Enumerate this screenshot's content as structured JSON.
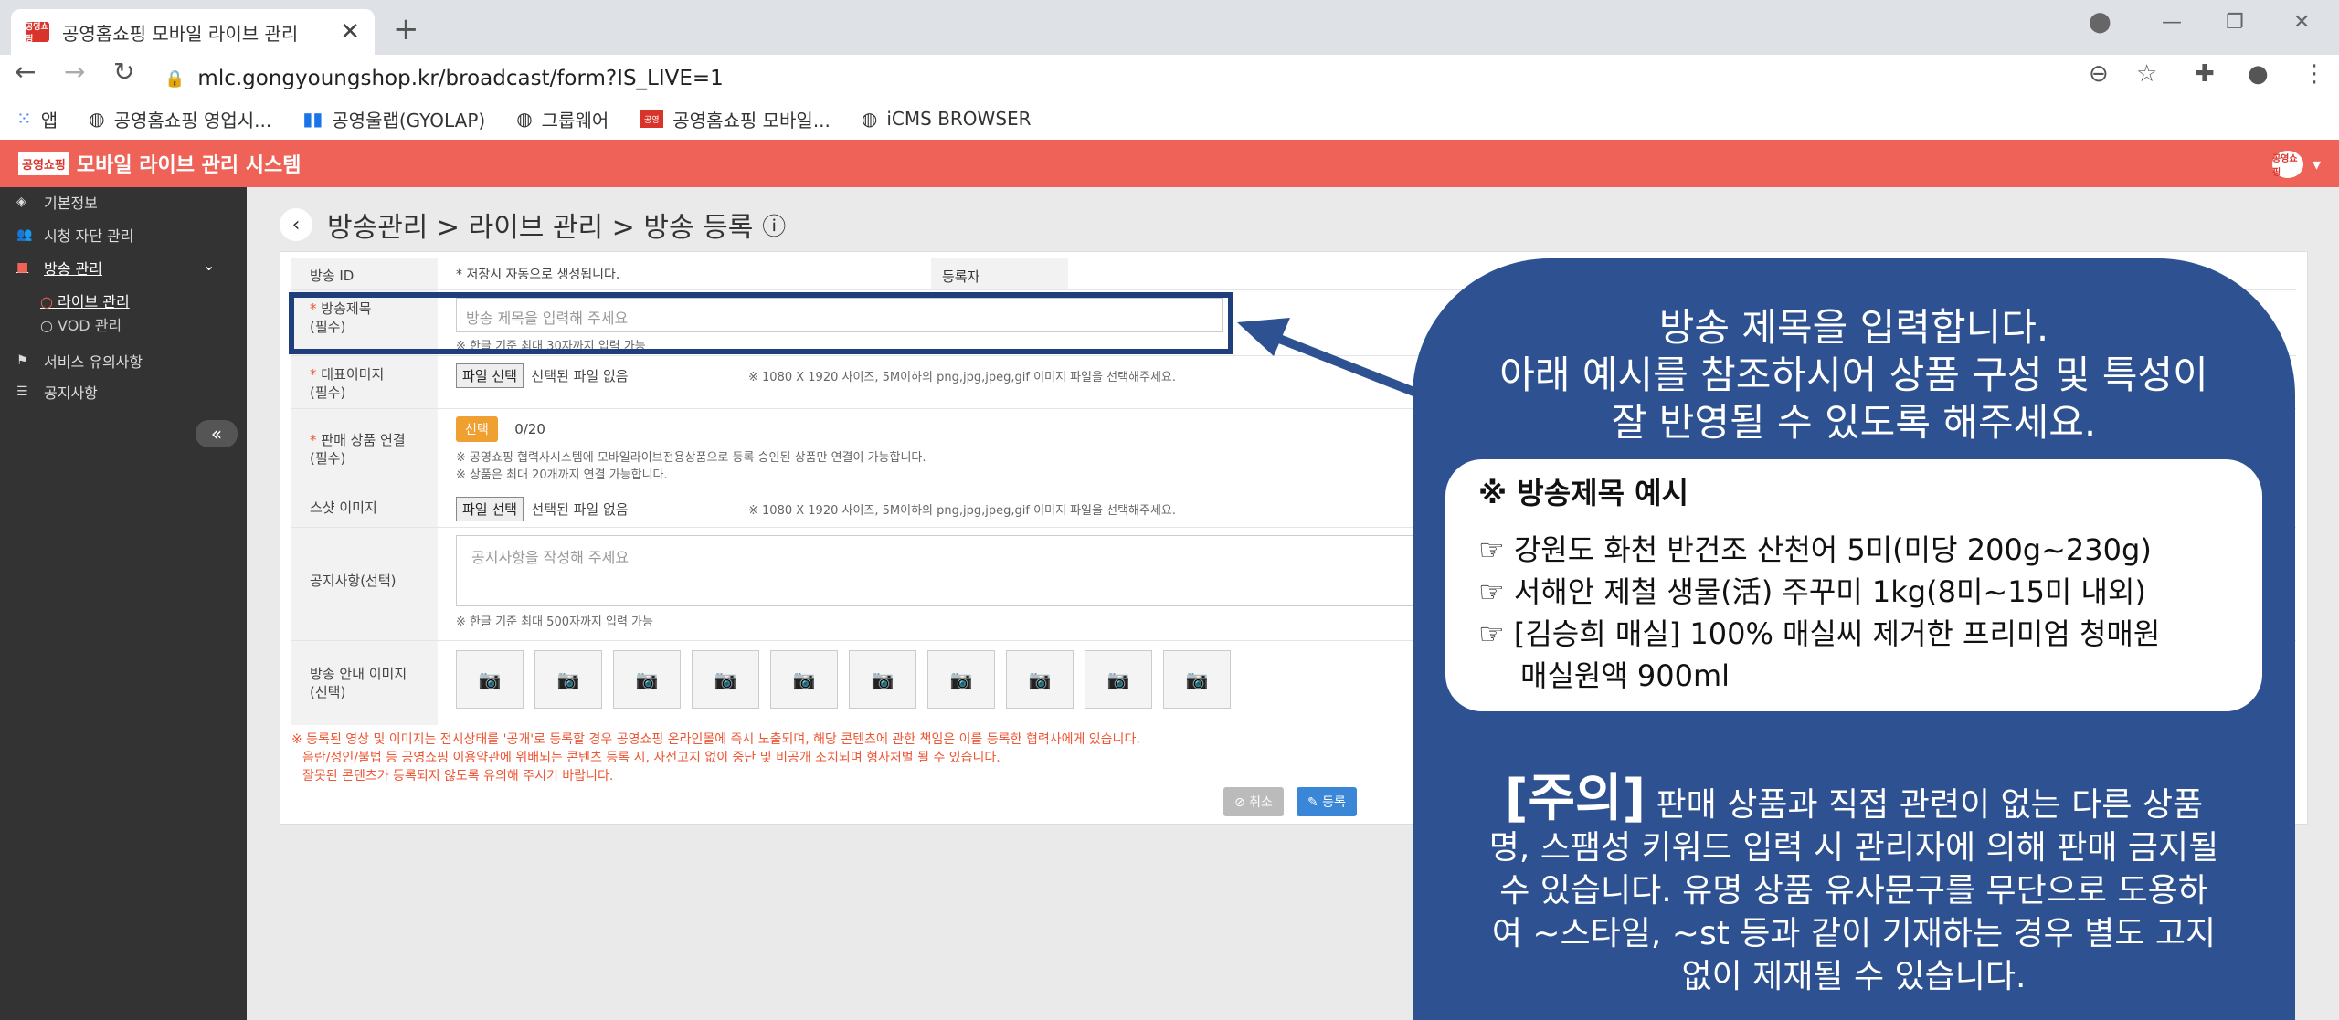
{
  "browser": {
    "tab_title": "공영홈쇼핑 모바일 라이브 관리",
    "favicon_text": "공영쇼핑",
    "new_tab": "+",
    "url_host": "mlc.gongyoungshop.kr",
    "url_path": "/broadcast/form?IS_LIVE=1",
    "bookmarks": [
      {
        "icon": "apps-icon",
        "label": "앱"
      },
      {
        "icon": "globe-icon",
        "label": "공영홈쇼핑 영업시..."
      },
      {
        "icon": "chart-icon",
        "label": "공영울랩(GYOLAP)"
      },
      {
        "icon": "globe-icon",
        "label": "그룹웨어"
      },
      {
        "icon": "brand-icon",
        "label": "공영홈쇼핑 모바일..."
      },
      {
        "icon": "globe-icon",
        "label": "iCMS BROWSER"
      }
    ]
  },
  "app": {
    "logo_text": "공영쇼핑",
    "title": "모바일 라이브 관리 시스템",
    "user_icon_text": "공영쇼핑"
  },
  "sidebar": {
    "items": [
      {
        "label": "기본정보",
        "icon": "tag-icon"
      },
      {
        "label": "시청 자단 관리",
        "icon": "users-icon"
      },
      {
        "label": "방송 관리",
        "icon": "video-icon"
      },
      {
        "label": "서비스 유의사항",
        "icon": "flag-icon"
      },
      {
        "label": "공지사항",
        "icon": "list-icon"
      }
    ],
    "sub_items": [
      {
        "label": "라이브 관리"
      },
      {
        "label": "VOD 관리"
      }
    ],
    "collapse": "«"
  },
  "breadcrumb": {
    "text": "방송관리 > 라이브 관리 > 방송 등록"
  },
  "form": {
    "broadcast_id_label": "방송 ID",
    "broadcast_id_value": "* 저장시 자동으로 생성됩니다.",
    "registrant_label": "등록자",
    "title_label": "방송제목",
    "title_req": "(필수)",
    "title_placeholder": "방송 제목을 입력해 주세요",
    "title_hint": "※ 한글 기준 최대 30자까지 입력 가능",
    "rep_image_label": "대표이미지",
    "rep_image_req": "(필수)",
    "file_button": "파일 선택",
    "file_none": "선택된 파일 없음",
    "file_hint": "※ 1080 X 1920 사이즈, 5M이하의 png,jpg,jpeg,gif 이미지 파일을 선택해주세요.",
    "product_label": "판매 상품 연결",
    "product_req": "(필수)",
    "select_button": "선택",
    "product_count": "0/20",
    "product_hint1": "※ 공영쇼핑 협력사시스템에 모바일라이브전용상품으로 등록 승인된 상품만 연결이 가능합니다.",
    "product_hint2": "※ 상품은 최대 20개까지 연결 가능합니다.",
    "shot_label": "스샷 이미지",
    "notice_label": "공지사항(선택)",
    "notice_placeholder": "공지사항을 작성해 주세요",
    "notice_hint": "※ 한글 기준 최대 500자까지 입력 가능",
    "guide_image_label": "방송 안내 이미지",
    "guide_image_opt": "(선택)",
    "bottom_notice1": "※ 등록된 영상 및 이미지는 전시상태를 '공개'로 등록할 경우 공영쇼핑 온라인몰에 즉시 노출되며, 해당 콘텐츠에 관한 책임은 이를 등록한 협력사에게 있습니다.",
    "bottom_notice2": "음란/성인/불법 등 공영쇼핑 이용약관에 위배되는 콘텐츠 등록 시, 사전고지 없이 중단 및 비공개 조치되며 형사처벌 될 수 있습니다.",
    "bottom_notice3": "잘못된 콘텐츠가 등록되지 않도록 유의해 주시기 바랍니다.",
    "cancel_button": "⊘ 취소",
    "save_button": "✎ 등록"
  },
  "callout": {
    "line1": "방송 제목을 입력합니다.",
    "line2": "아래 예시를 참조하시어 상품 구성 및 특성이",
    "line3": "잘 반영될 수 있도록 해주세요.",
    "example_title": "※ 방송제목 예시",
    "example1": "☞ 강원도 화천 반건조 산천어 5미(미당 200g~230g)",
    "example2": "☞ 서해안 제철 생물(活) 주꾸미 1kg(8미~15미 내외)",
    "example3": "☞ [김승희 매실] 100% 매실씨 제거한 프리미엄 청매원",
    "example4": "매실원액 900ml",
    "warn_head": "[주의]",
    "warn_text": " 판매 상품과 직접 관련이 없는 다른 상품명, 스팸성 키워드 입력 시 관리자에 의해 판매 금지될 수 있습니다. 유명 상품 유사문구를 무단으로 도용하여 ~스타일, ~st 등과 같이 기재하는 경우 별도 고지 없이 제재될 수 있습니다."
  },
  "colors": {
    "header": "#ee6258",
    "sidebar": "#333333",
    "callout": "#2d5191",
    "highlight_border": "#1f3f7c",
    "save": "#3a87d8",
    "select": "#f0a030"
  }
}
